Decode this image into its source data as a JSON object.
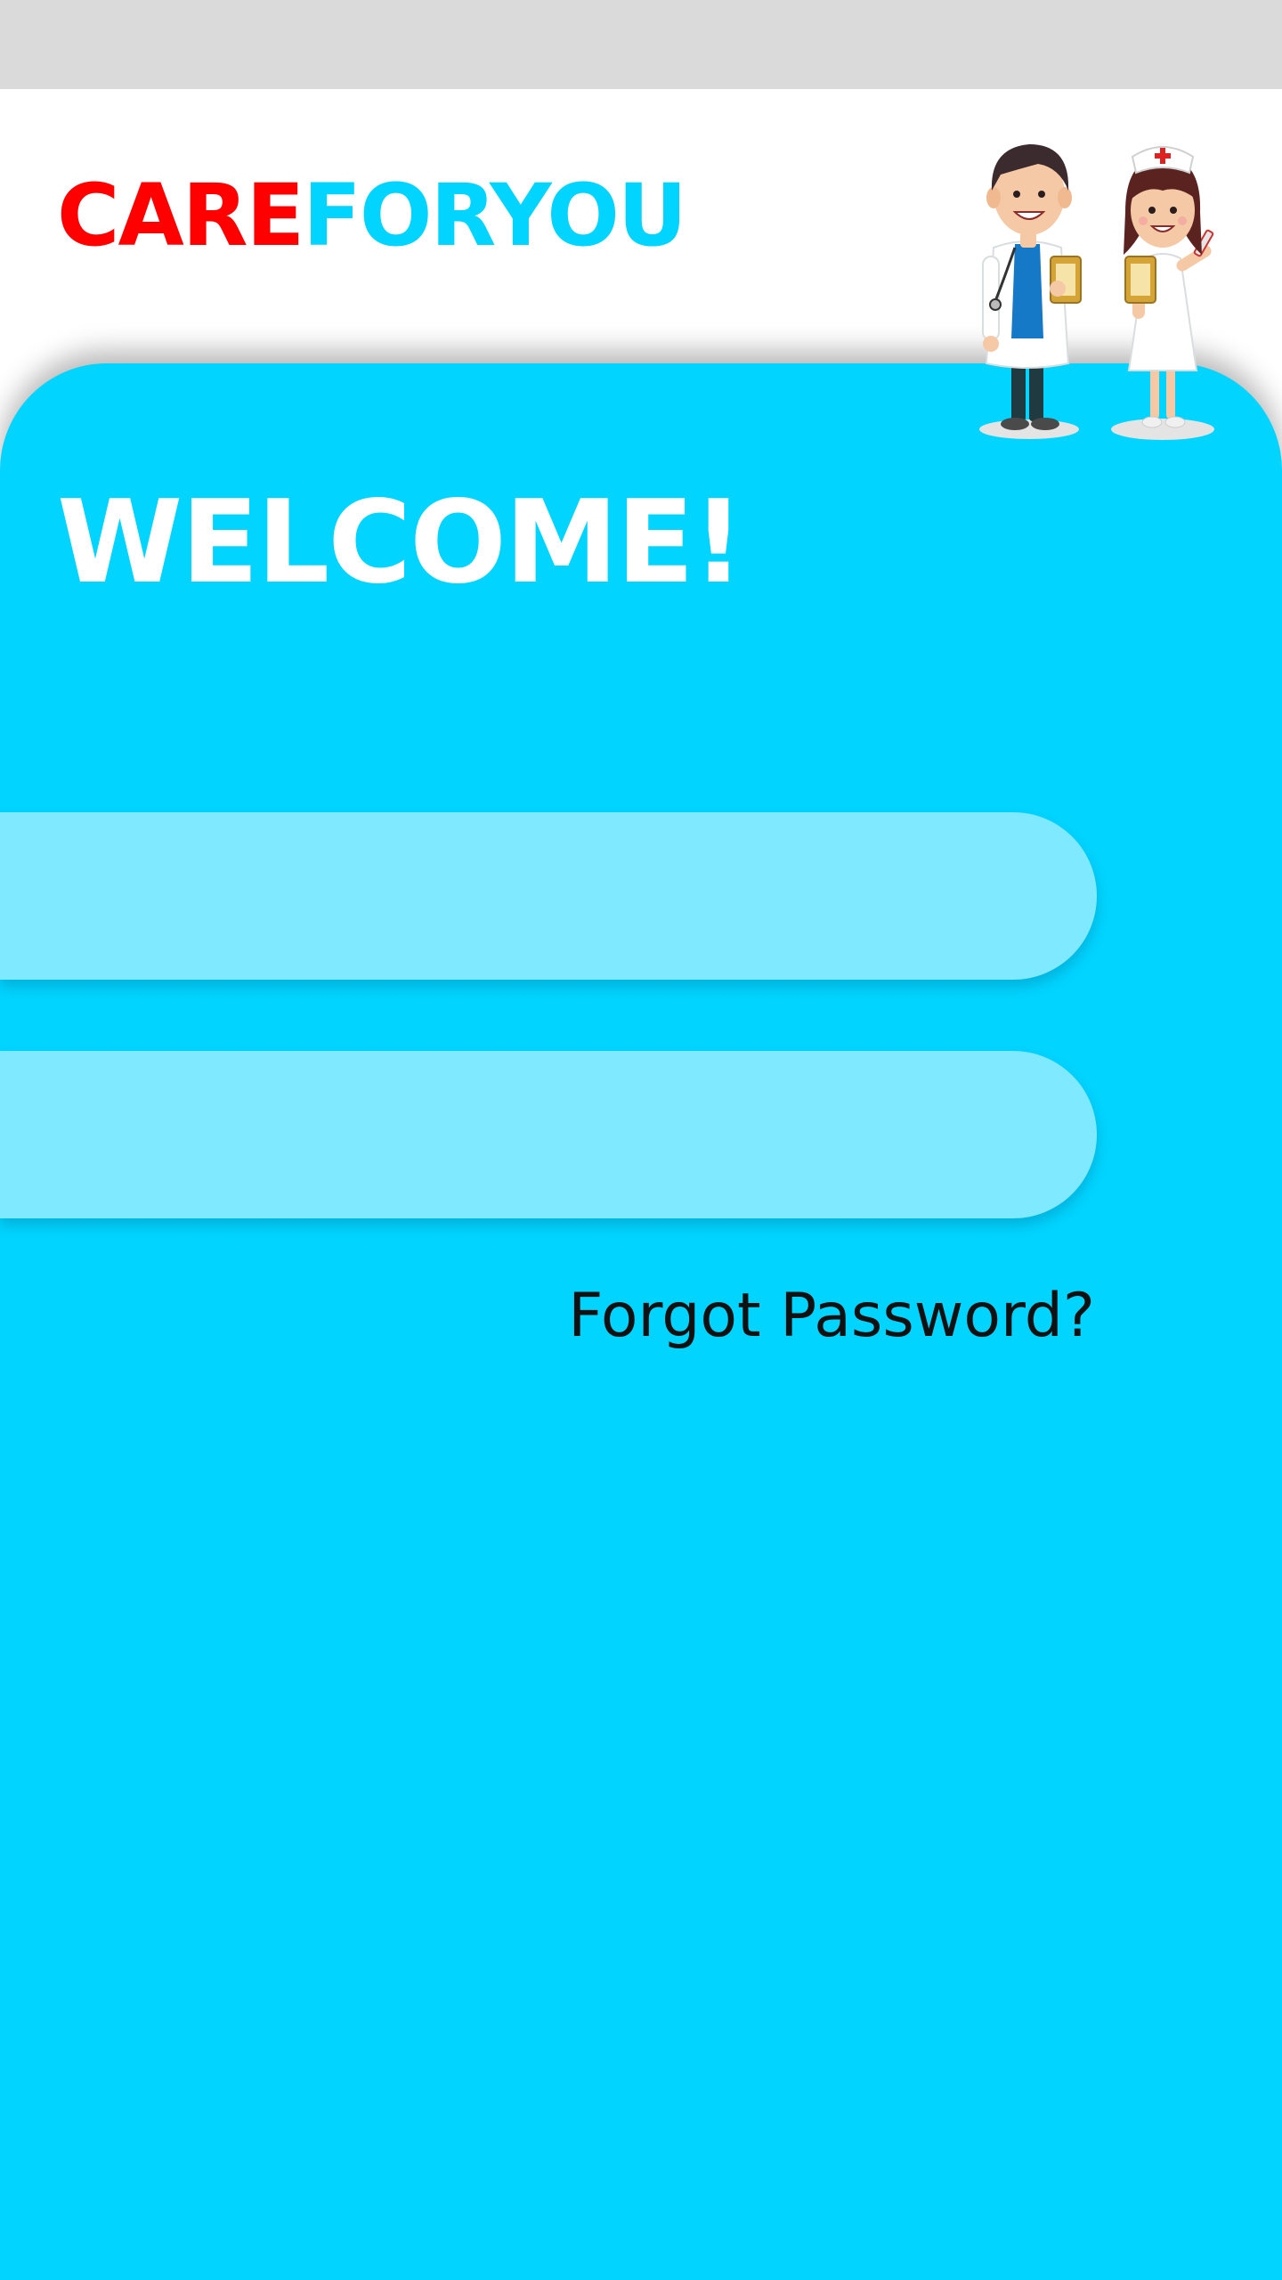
{
  "brand": {
    "part1": "CARE",
    "part2": "FORYOU",
    "color_part1": "#ff0000",
    "color_part2": "#00d4ff"
  },
  "welcome_title": "WELCOME!",
  "form": {
    "username_value": "",
    "password_value": "",
    "forgot_password_label": "Forgot Password?"
  },
  "illustration": {
    "icon": "doctor-and-nurse-illustration"
  },
  "colors": {
    "panel": "#00d4ff",
    "field": "#7fe9ff",
    "status_bar": "#dadada"
  }
}
